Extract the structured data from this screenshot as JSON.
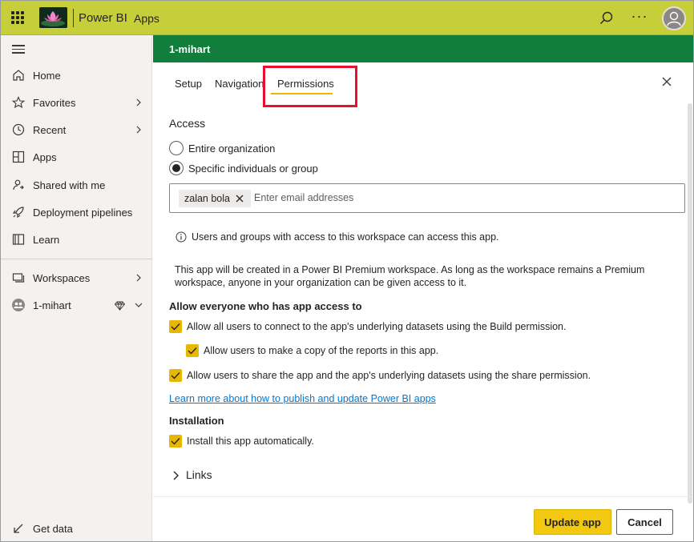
{
  "topbar": {
    "brand": "Power BI",
    "breadcrumb": "Apps",
    "icons": [
      "app-launcher-icon",
      "search-icon",
      "more-options-icon",
      "user-avatar-icon"
    ],
    "accent_color": "#c6cf3a"
  },
  "sidebar": {
    "items": [
      {
        "label": "Home",
        "icon": "home-icon"
      },
      {
        "label": "Favorites",
        "icon": "star-icon",
        "expandable": true
      },
      {
        "label": "Recent",
        "icon": "clock-icon",
        "expandable": true
      },
      {
        "label": "Apps",
        "icon": "apps-icon"
      },
      {
        "label": "Shared with me",
        "icon": "shared-icon"
      },
      {
        "label": "Deployment pipelines",
        "icon": "rocket-icon"
      },
      {
        "label": "Learn",
        "icon": "book-icon"
      }
    ],
    "workspaces": {
      "label": "Workspaces",
      "icon": "workspaces-icon"
    },
    "current_workspace": {
      "label": "1-mihart",
      "icon": "workspace-avatar-icon",
      "premium_icon": "diamond-icon"
    },
    "get_data": {
      "label": "Get data",
      "icon": "get-data-arrow-icon"
    }
  },
  "header": {
    "title": "1-mihart",
    "color": "#117e3b"
  },
  "tabs": [
    {
      "label": "Setup",
      "active": false
    },
    {
      "label": "Navigation",
      "active": false
    },
    {
      "label": "Permissions",
      "active": true
    }
  ],
  "access": {
    "heading": "Access",
    "options": [
      {
        "label": "Entire organization",
        "selected": false
      },
      {
        "label": "Specific individuals or group",
        "selected": true
      }
    ],
    "chips": [
      "zalan bola"
    ],
    "email_placeholder": "Enter email addresses",
    "info_text": "Users and groups with access to this workspace can access this app.",
    "premium_text": "This app will be created in a Power BI Premium workspace. As long as the workspace remains a Premium workspace, anyone in your organization can be given access to it."
  },
  "allow": {
    "heading": "Allow everyone who has app access to",
    "options": [
      {
        "label": "Allow all users to connect to the app's underlying datasets using the Build permission.",
        "checked": true
      },
      {
        "label": "Allow users to make a copy of the reports in this app.",
        "checked": true
      },
      {
        "label": "Allow users to share the app and the app's underlying datasets using the share permission.",
        "checked": true
      }
    ],
    "learn_link": "Learn more about how to publish and update Power BI apps"
  },
  "installation": {
    "heading": "Installation",
    "option": {
      "label": "Install this app automatically.",
      "checked": true
    }
  },
  "links_section": {
    "label": "Links"
  },
  "footer": {
    "primary_label": "Update app",
    "secondary_label": "Cancel",
    "primary_color": "#f2c811"
  }
}
